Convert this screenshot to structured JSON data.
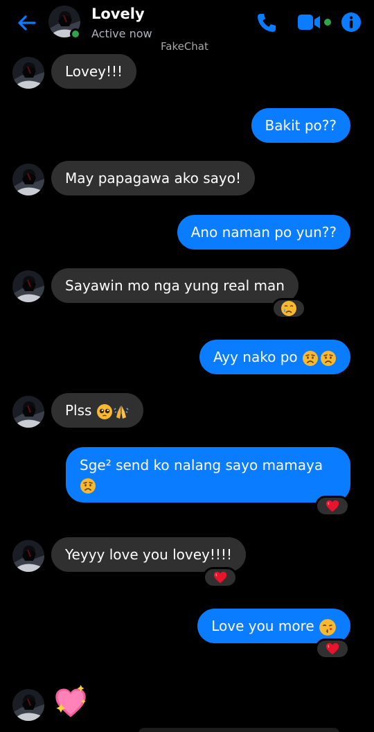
{
  "header": {
    "name": "Lovely",
    "status": "Active now",
    "watermark": "FakeChat"
  },
  "colors": {
    "accent": "#0a7cff",
    "incoming_bubble": "#303030",
    "online": "#31a24c",
    "background": "#000000"
  },
  "messages": [
    {
      "sender": "them",
      "text": "Lovey!!!"
    },
    {
      "sender": "me",
      "text": "Bakit po??"
    },
    {
      "sender": "them",
      "text": "May papagawa ako sayo!"
    },
    {
      "sender": "me",
      "text": "Ano naman po yun??"
    },
    {
      "sender": "them",
      "text": "Sayawin mo nga yung real man",
      "reaction": "crying-face"
    },
    {
      "sender": "me",
      "text": "Ayy nako po",
      "emojis": [
        "worried-face",
        "worried-face"
      ]
    },
    {
      "sender": "them",
      "text": "Plss",
      "emojis": [
        "pleading-face",
        "folded-hands"
      ]
    },
    {
      "sender": "me",
      "text": "Sge² send ko nalang sayo mamaya",
      "emojis": [
        "worried-face"
      ],
      "reaction": "red-heart"
    },
    {
      "sender": "them",
      "text": "Yeyyy love you lovey!!!!",
      "reaction": "red-heart"
    },
    {
      "sender": "me",
      "text": "Love you more",
      "emojis": [
        "kissing-heart-face"
      ],
      "reaction": "red-heart"
    },
    {
      "sender": "them",
      "text": "",
      "emojis": [
        "sparkling-heart"
      ]
    }
  ]
}
